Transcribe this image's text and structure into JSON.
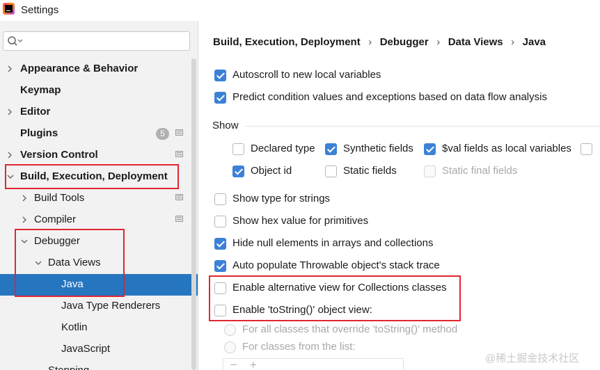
{
  "window": {
    "title": "Settings",
    "logo_text": "IJ"
  },
  "search": {
    "placeholder": "",
    "value": ""
  },
  "sidebar": {
    "items": [
      {
        "label": "Appearance & Behavior"
      },
      {
        "label": "Keymap"
      },
      {
        "label": "Editor"
      },
      {
        "label": "Plugins",
        "badge": "5"
      },
      {
        "label": "Version Control"
      },
      {
        "label": "Build, Execution, Deployment"
      },
      {
        "label": "Build Tools"
      },
      {
        "label": "Compiler"
      },
      {
        "label": "Debugger"
      },
      {
        "label": "Data Views"
      },
      {
        "label": "Java"
      },
      {
        "label": "Java Type Renderers"
      },
      {
        "label": "Kotlin"
      },
      {
        "label": "JavaScript"
      },
      {
        "label": "Stepping"
      }
    ]
  },
  "breadcrumb": [
    "Build, Execution, Deployment",
    "Debugger",
    "Data Views",
    "Java"
  ],
  "options": {
    "autoscroll": {
      "label": "Autoscroll to new local variables",
      "checked": true
    },
    "predict": {
      "label": "Predict condition values and exceptions based on data flow analysis",
      "checked": true
    },
    "show_group": "Show",
    "declared_type": {
      "label": "Declared type",
      "checked": false
    },
    "synthetic_fields": {
      "label": "Synthetic fields",
      "checked": true
    },
    "val_fields": {
      "label": "$val fields as local variables",
      "checked": true
    },
    "object_id": {
      "label": "Object id",
      "checked": true
    },
    "static_fields": {
      "label": "Static fields",
      "checked": false
    },
    "static_final_fields": {
      "label": "Static final fields",
      "checked": false,
      "disabled": true
    },
    "type_strings": {
      "label": "Show type for strings",
      "checked": false
    },
    "hex_primitives": {
      "label": "Show hex value for primitives",
      "checked": false
    },
    "hide_null": {
      "label": "Hide null elements in arrays and collections",
      "checked": true
    },
    "auto_populate": {
      "label": "Auto populate Throwable object's stack trace",
      "checked": true
    },
    "alt_view": {
      "label": "Enable alternative view for Collections classes",
      "checked": false
    },
    "tostring_view": {
      "label": "Enable 'toString()' object view:",
      "checked": false
    },
    "radio_all": {
      "label": "For all classes that override 'toString()' method"
    },
    "radio_list": {
      "label": "For classes from the list:"
    }
  },
  "list_toolbar": {
    "add": "+",
    "remove": "−"
  },
  "watermark": "@稀土掘金技术社区",
  "colors": {
    "selection": "#2675bf",
    "checkbox": "#3b82d6",
    "highlight_box": "#e0262e"
  }
}
